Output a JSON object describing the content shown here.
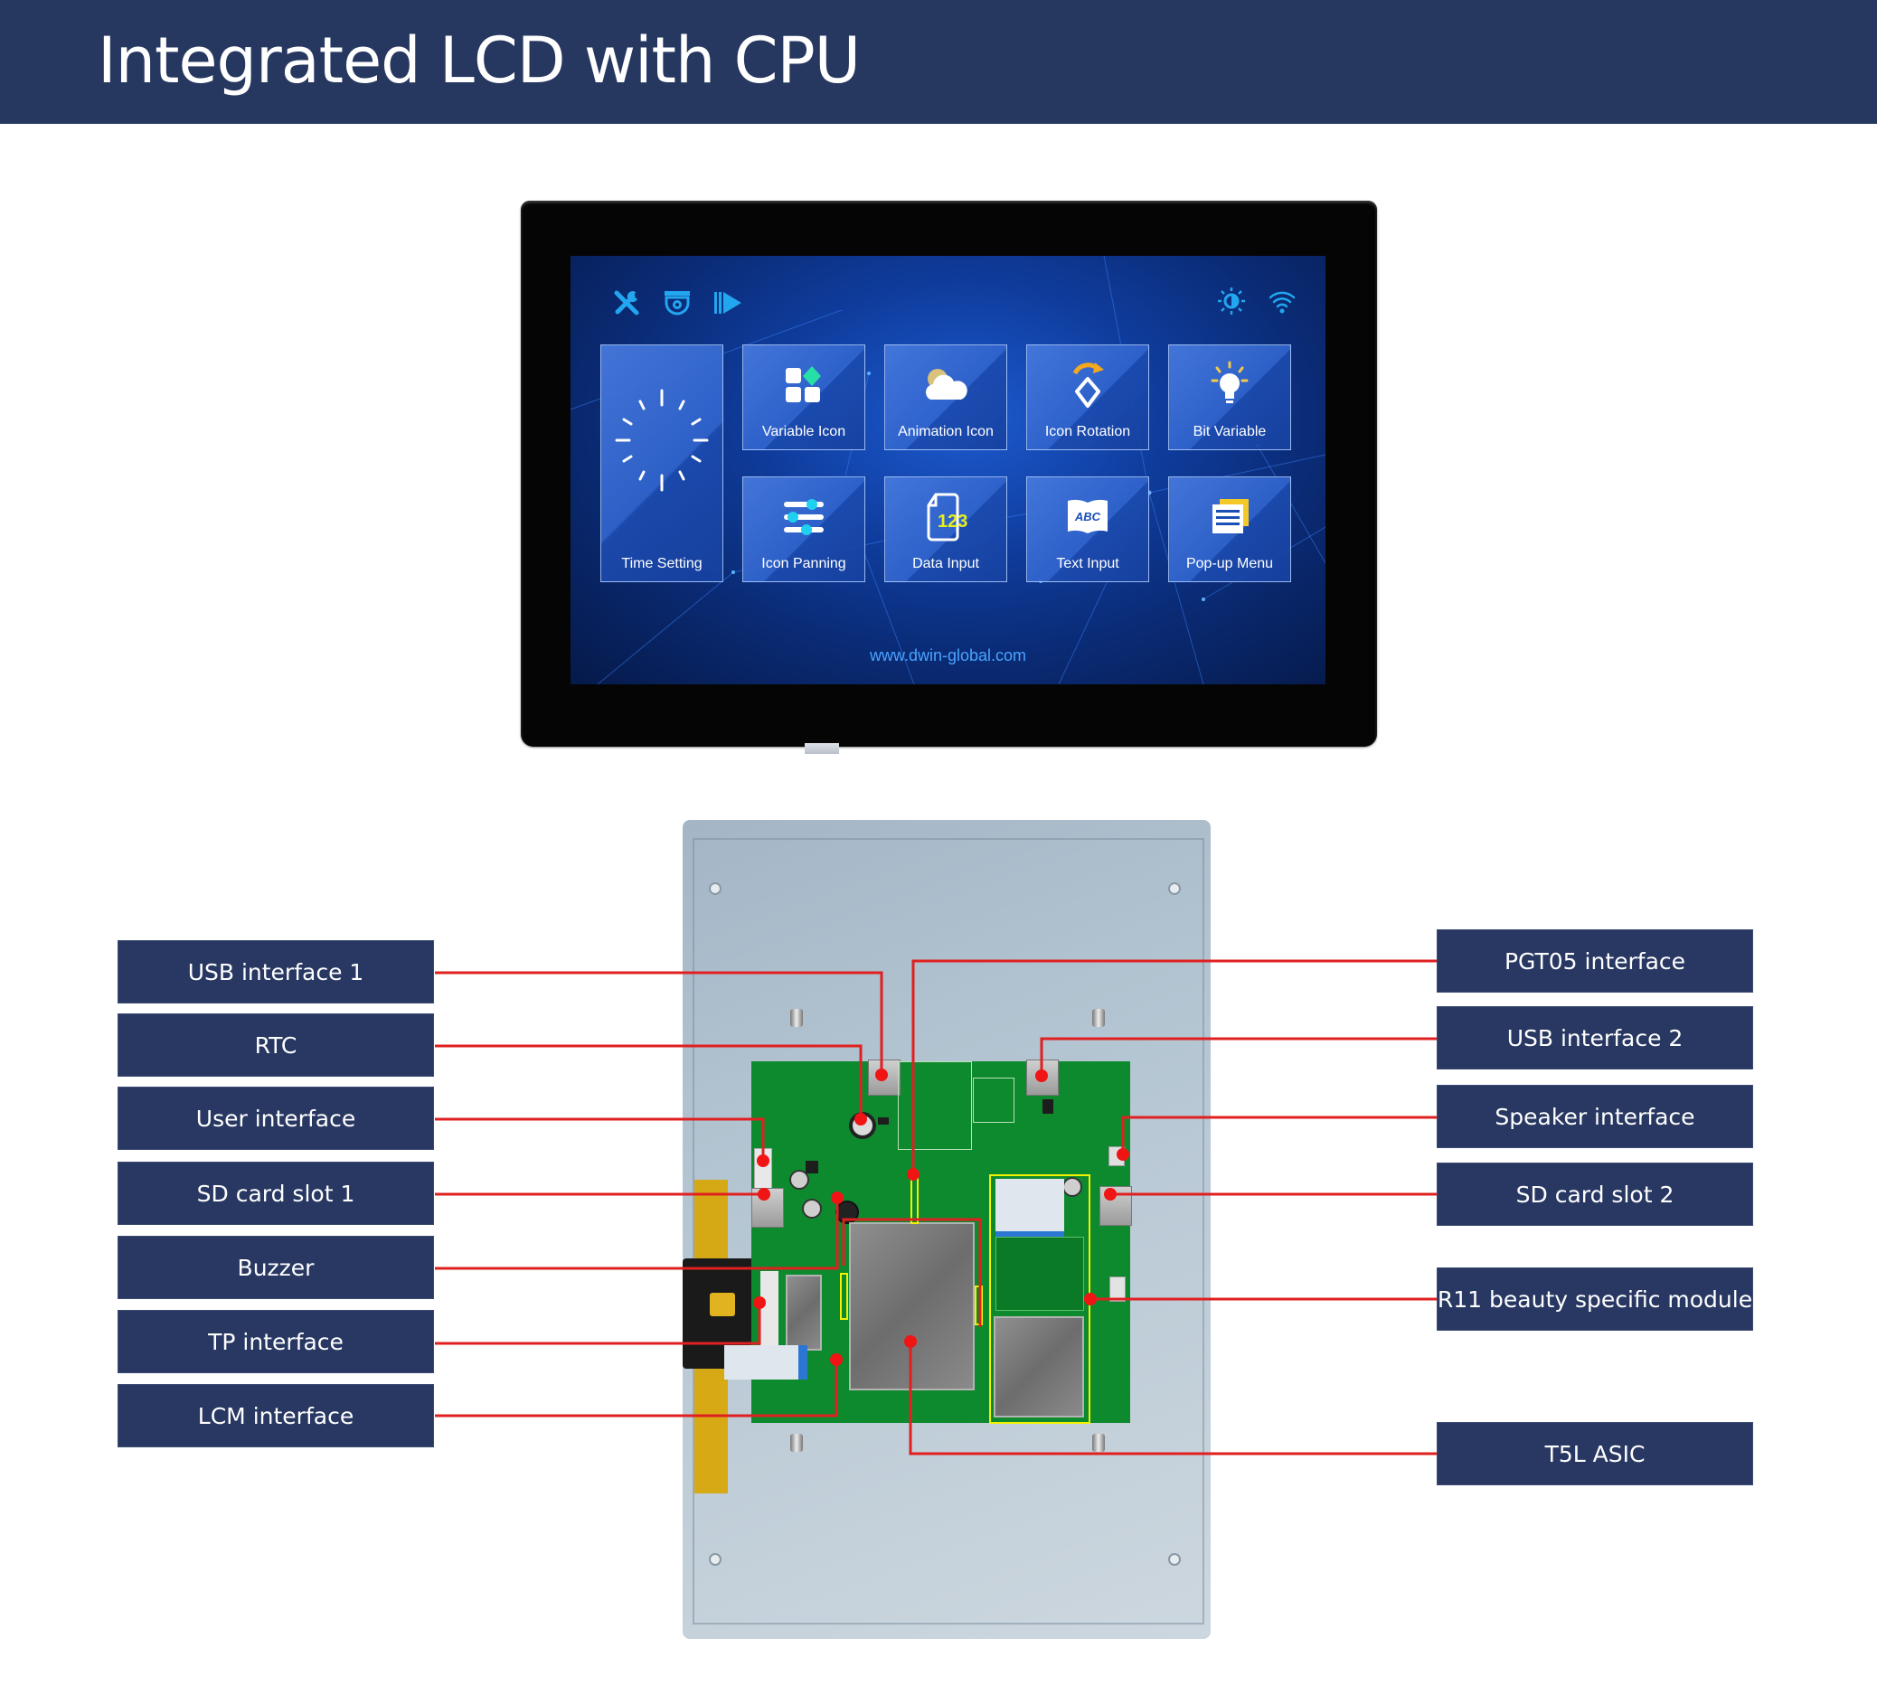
{
  "header": {
    "title": "Integrated LCD with CPU"
  },
  "colors": {
    "header_bg": "#263760",
    "label_bg": "#283862",
    "leader_line": "#e02020",
    "highlight_box": "#f1f100",
    "pcb": "#0e8a2e"
  },
  "front_display": {
    "status_icons": [
      "tools-icon",
      "camera-icon",
      "play-icon",
      "brightness-icon",
      "wifi-icon"
    ],
    "tiles": [
      {
        "label": "Time Setting",
        "icon": "clock-dial-icon"
      },
      {
        "label": "Variable Icon",
        "icon": "grid-diamond-icon"
      },
      {
        "label": "Animation Icon",
        "icon": "cloud-moon-icon"
      },
      {
        "label": "Icon Rotation",
        "icon": "rotate-diamond-icon"
      },
      {
        "label": "Bit Variable",
        "icon": "lightbulb-icon"
      },
      {
        "label": "Icon Panning",
        "icon": "sliders-icon"
      },
      {
        "label": "Data Input",
        "icon": "document-123-icon",
        "icon_text": "123"
      },
      {
        "label": "Text Input",
        "icon": "book-abc-icon",
        "icon_text": "ABC"
      },
      {
        "label": "Pop-up Menu",
        "icon": "menu-stack-icon"
      }
    ],
    "url": "www.dwin-global.com"
  },
  "callouts": {
    "left": [
      {
        "label": "USB interface 1"
      },
      {
        "label": "RTC"
      },
      {
        "label": "User interface"
      },
      {
        "label": "SD card slot 1"
      },
      {
        "label": "Buzzer"
      },
      {
        "label": "TP interface"
      },
      {
        "label": "LCM interface"
      }
    ],
    "right": [
      {
        "label": "PGT05 interface"
      },
      {
        "label": "USB interface 2"
      },
      {
        "label": "Speaker interface"
      },
      {
        "label": "SD card slot 2"
      },
      {
        "label": "R11 beauty specific module"
      },
      {
        "label": "T5L ASIC"
      }
    ]
  }
}
